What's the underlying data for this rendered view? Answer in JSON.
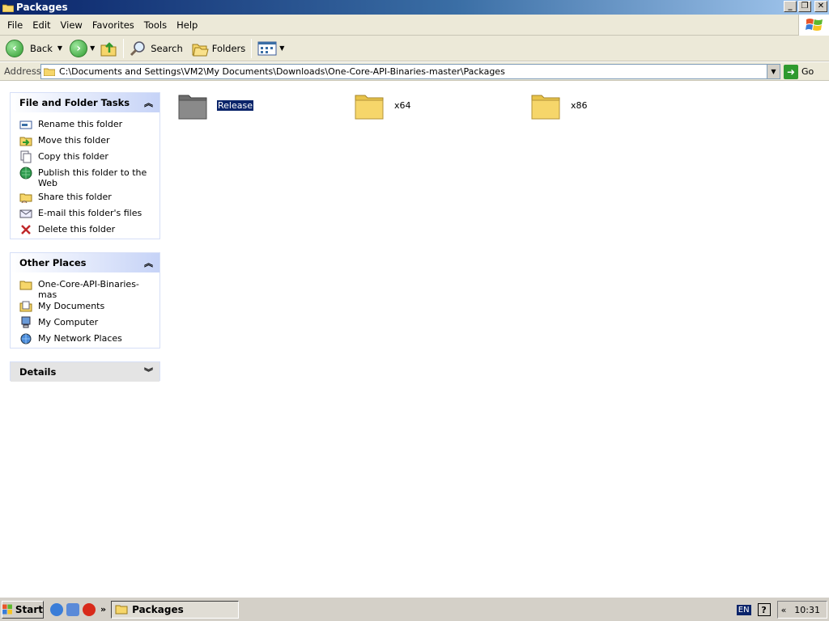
{
  "window": {
    "title": "Packages"
  },
  "menubar": {
    "items": [
      "File",
      "Edit",
      "View",
      "Favorites",
      "Tools",
      "Help"
    ]
  },
  "toolbar": {
    "back_label": "Back",
    "search_label": "Search",
    "folders_label": "Folders"
  },
  "address": {
    "label": "Address",
    "value": "C:\\Documents and Settings\\VM2\\My Documents\\Downloads\\One-Core-API-Binaries-master\\Packages",
    "go_label": "Go"
  },
  "sidebar": {
    "tasks": {
      "title": "File and Folder Tasks",
      "items": [
        {
          "label": "Rename this folder",
          "icon": "rename-icon"
        },
        {
          "label": "Move this folder",
          "icon": "move-icon"
        },
        {
          "label": "Copy this folder",
          "icon": "copy-icon"
        },
        {
          "label": "Publish this folder to the Web",
          "icon": "publish-web-icon"
        },
        {
          "label": "Share this folder",
          "icon": "share-icon"
        },
        {
          "label": "E-mail this folder's files",
          "icon": "email-icon"
        },
        {
          "label": "Delete this folder",
          "icon": "delete-icon"
        }
      ]
    },
    "places": {
      "title": "Other Places",
      "items": [
        {
          "label": "One-Core-API-Binaries-mas",
          "icon": "folder-icon"
        },
        {
          "label": "My Documents",
          "icon": "my-documents-icon"
        },
        {
          "label": "My Computer",
          "icon": "my-computer-icon"
        },
        {
          "label": "My Network Places",
          "icon": "network-places-icon"
        }
      ]
    },
    "details": {
      "title": "Details"
    }
  },
  "content": {
    "folders": [
      {
        "name": "Release",
        "selected": true
      },
      {
        "name": "x64",
        "selected": false
      },
      {
        "name": "x86",
        "selected": false
      }
    ]
  },
  "taskbar": {
    "start_label": "Start",
    "task_button": "Packages",
    "language": "EN",
    "clock": "10:31"
  },
  "colors": {
    "selection": "#0a246a",
    "panel_title": "#215dc6",
    "folder_yellow": "#f6d66a"
  }
}
